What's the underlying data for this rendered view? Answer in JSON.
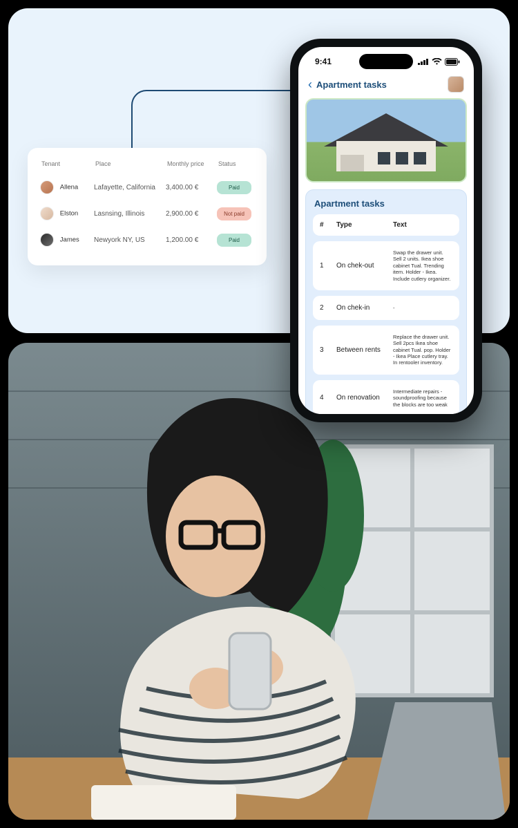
{
  "tenant_table": {
    "headers": {
      "tenant": "Tenant",
      "place": "Place",
      "price": "Monthly price",
      "status": "Status"
    },
    "rows": [
      {
        "name": "Allena",
        "place": "Lafayette, California",
        "price": "3,400.00 €",
        "status": "Paid",
        "status_kind": "paid"
      },
      {
        "name": "Elston",
        "place": "Lasnsing, Illinois",
        "price": "2,900.00 €",
        "status": "Not paid",
        "status_kind": "notpaid"
      },
      {
        "name": "James",
        "place": "Newyork NY, US",
        "price": "1,200.00 €",
        "status": "Paid",
        "status_kind": "paid"
      }
    ]
  },
  "phone": {
    "statusbar": {
      "time": "9:41"
    },
    "header_title": "Apartment tasks",
    "tasks_panel_title": "Apartment tasks",
    "task_headers": {
      "num": "#",
      "type": "Type",
      "text": "Text"
    },
    "tasks": [
      {
        "num": "1",
        "type": "On chek-out",
        "text": "Swap the drawer unit. Sell 2 units. Ikea shoe cabinet Tual. Trending item. Holder - Ikea. Include cutlery organizer."
      },
      {
        "num": "2",
        "type": "On chek-in",
        "text": "-"
      },
      {
        "num": "3",
        "type": "Between rents",
        "text": "Replace the drawer unit. Sell 2pcs Ikea shoe cabinet Tual. pop. Holder - Ikea Place cutlery tray. In rentooler inventory."
      },
      {
        "num": "4",
        "type": "On renovation",
        "text": "Intermediate repairs - soundproofing because the blocks are too weak"
      }
    ]
  }
}
